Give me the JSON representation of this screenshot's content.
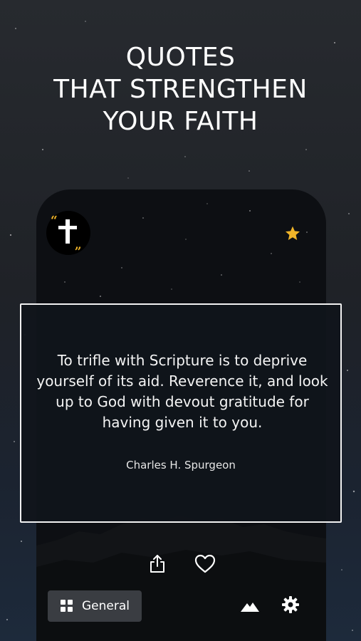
{
  "headline": {
    "line1": "QUOTES",
    "line2": "THAT STRENGTHEN",
    "line3": "YOUR FAITH"
  },
  "app": {
    "logo": {
      "icon": "quote-cross-icon",
      "quote_open": "“",
      "quote_close": "„"
    },
    "favorite_icon": "star-icon",
    "quote": {
      "text": "To trifle with Scripture is to deprive yourself of its aid. Reverence it, and look up to God with devout gratitude for having given it to you.",
      "author": "Charles H. Spurgeon"
    },
    "actions": {
      "share_icon": "share-icon",
      "like_icon": "heart-icon"
    },
    "bottom_bar": {
      "category_icon": "grid-icon",
      "category_label": "General",
      "themes_icon": "mountain-icon",
      "settings_icon": "gear-icon"
    }
  },
  "colors": {
    "accent": "#f0b429",
    "card_border": "#f2f2f2",
    "phone_bg": "#0d0f13",
    "button_bg": "#3a3d42"
  }
}
